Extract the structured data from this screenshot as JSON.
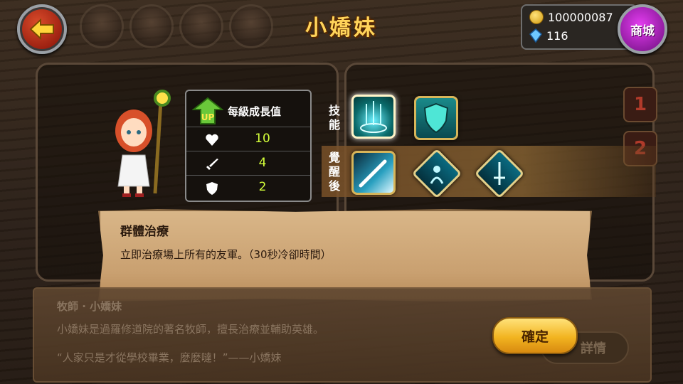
{
  "header": {
    "title": "小嬌妹",
    "coins": "100000087",
    "gems": "116",
    "shop_label": "商城",
    "icons": {
      "back": "back-arrow-icon",
      "coin": "coin-icon",
      "gem": "diamond-gem-icon"
    }
  },
  "stats": {
    "title": "每級成長值",
    "up_badge": "UP",
    "rows": [
      {
        "icon": "heart-icon",
        "value": "10"
      },
      {
        "icon": "sword-icon",
        "value": "4"
      },
      {
        "icon": "shield-icon",
        "value": "2"
      }
    ]
  },
  "skills": {
    "label": "技能",
    "awaken_label": "覺醒後",
    "side_tabs": [
      "1",
      "2"
    ]
  },
  "tooltip": {
    "title": "群體治療",
    "description": "立即治療場上所有的友軍。（30秒冷卻時間）"
  },
  "info": {
    "line1": "牧師 · 小嬌妹",
    "line2": "小嬌妹是過羅修道院的著名牧師，擅長治療並輔助英雄。",
    "quote": "“人家只是才從學校畢業，麼麼噠！”——小嬌妹",
    "detail_label": "詳情"
  },
  "confirm_label": "確定",
  "colors": {
    "title": "#ffd45a",
    "stat_value": "#d4ff3a",
    "shop": "#c42ad6",
    "confirm": "#f2b420"
  }
}
